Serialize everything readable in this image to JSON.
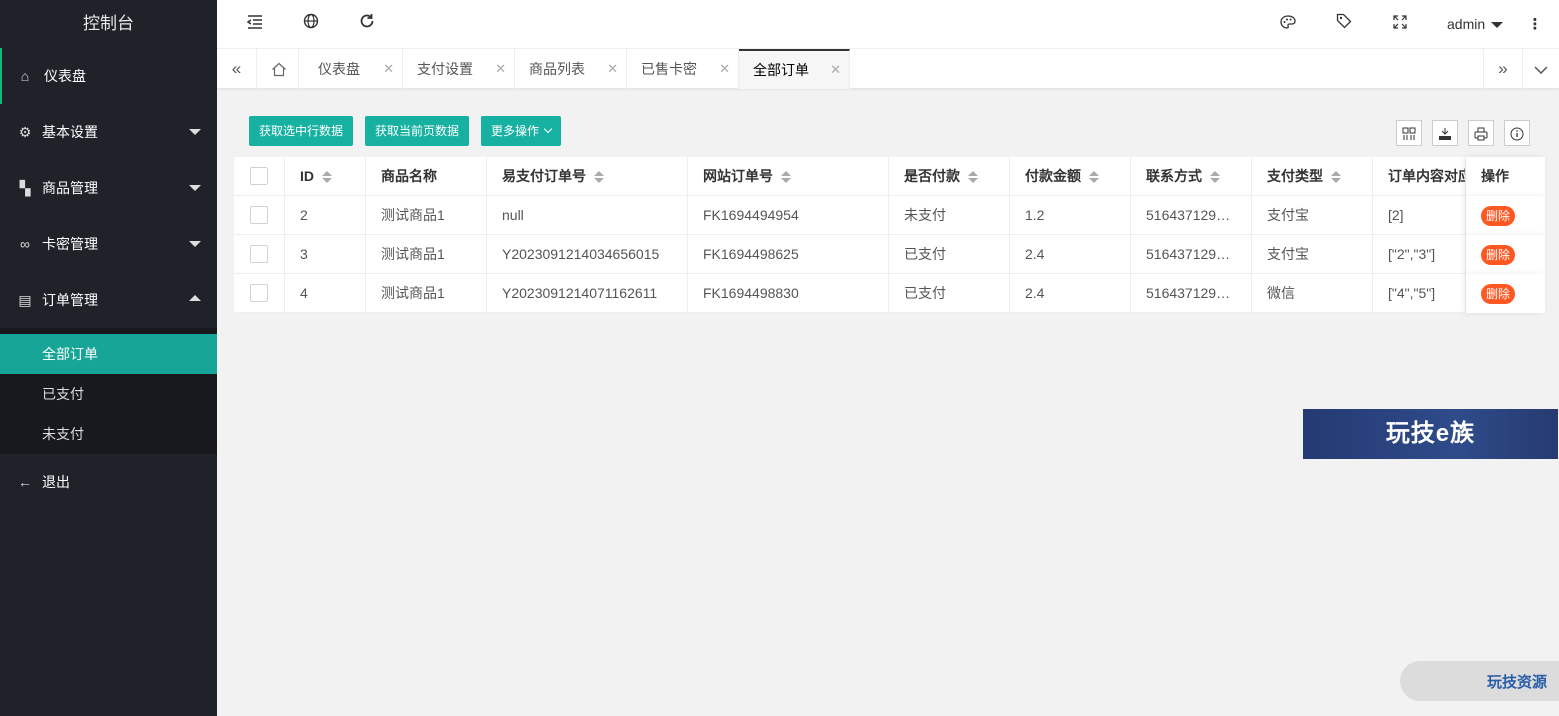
{
  "app": {
    "title": "控制台"
  },
  "sidebar": {
    "items": [
      {
        "label": "仪表盘",
        "icon": "home-icon"
      },
      {
        "label": "基本设置",
        "icon": "gear-icon"
      },
      {
        "label": "商品管理",
        "icon": "apps-icon"
      },
      {
        "label": "卡密管理",
        "icon": "link-icon"
      },
      {
        "label": "订单管理",
        "icon": "document-icon"
      }
    ],
    "submenu": [
      {
        "label": "全部订单"
      },
      {
        "label": "已支付"
      },
      {
        "label": "未支付"
      }
    ],
    "logout": {
      "label": "退出",
      "icon": "arrow-left-icon"
    }
  },
  "header": {
    "user": "admin",
    "icons": [
      "menu-fold-icon",
      "globe-icon",
      "refresh-icon",
      "palette-icon",
      "tag-icon",
      "fullscreen-icon",
      "more-vertical-icon"
    ]
  },
  "tabs": [
    {
      "label": "仪表盘"
    },
    {
      "label": "支付设置"
    },
    {
      "label": "商品列表"
    },
    {
      "label": "已售卡密"
    },
    {
      "label": "全部订单"
    }
  ],
  "toolbar": {
    "btn_selected": "获取选中行数据",
    "btn_page": "获取当前页数据",
    "btn_more": "更多操作",
    "tool_icons": [
      "columns-icon",
      "export-icon",
      "print-icon",
      "info-icon"
    ]
  },
  "table": {
    "headers": [
      "ID",
      "商品名称",
      "易支付订单号",
      "网站订单号",
      "是否付款",
      "付款金额",
      "联系方式",
      "支付类型",
      "订单内容对应",
      "操作"
    ],
    "rows": [
      {
        "id": "2",
        "name": "测试商品1",
        "epay": "null",
        "site": "FK1694494954",
        "paid": "未支付",
        "amount": "1.2",
        "contact": "516437129…",
        "type": "支付宝",
        "content": "[2]",
        "action": "删除"
      },
      {
        "id": "3",
        "name": "测试商品1",
        "epay": "Y2023091214034656015",
        "site": "FK1694498625",
        "paid": "已支付",
        "amount": "2.4",
        "contact": "516437129…",
        "type": "支付宝",
        "content": "[\"2\",\"3\"]",
        "action": "删除"
      },
      {
        "id": "4",
        "name": "测试商品1",
        "epay": "Y2023091214071162611",
        "site": "FK1694498830",
        "paid": "已支付",
        "amount": "2.4",
        "contact": "516437129…",
        "type": "微信",
        "content": "[\"4\",\"5\"]",
        "action": "删除"
      }
    ]
  },
  "watermarks": {
    "top": "玩技e族",
    "bottom": "玩技资源"
  },
  "colors": {
    "sidebar_bg": "#20222a",
    "accent": "#16b1a0",
    "danger": "#ff5722",
    "active_sub": "#16a596"
  }
}
